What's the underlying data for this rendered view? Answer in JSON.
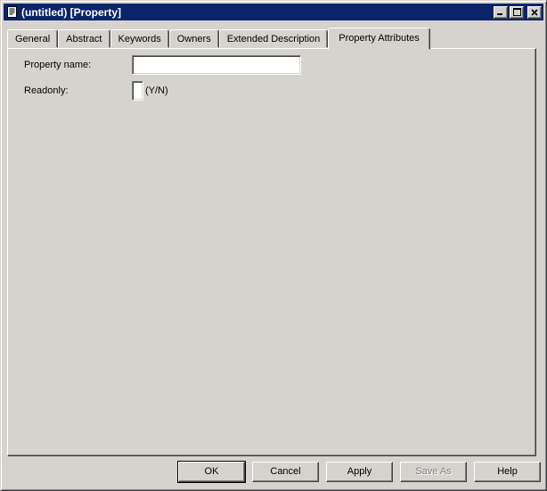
{
  "window": {
    "title": "(untitled) [Property]",
    "icon": "property-sheet-document-icon",
    "controls": {
      "minimize": "minimize-icon",
      "maximize": "maximize-icon",
      "close": "close-icon"
    }
  },
  "tabs": [
    {
      "label": "General",
      "active": false
    },
    {
      "label": "Abstract",
      "active": false
    },
    {
      "label": "Keywords",
      "active": false
    },
    {
      "label": "Owners",
      "active": false
    },
    {
      "label": "Extended Description",
      "active": false
    },
    {
      "label": "Property Attributes",
      "active": true
    }
  ],
  "form": {
    "property_name": {
      "label": "Property name:",
      "value": ""
    },
    "readonly": {
      "label": "Readonly:",
      "value": "",
      "hint": "(Y/N)"
    }
  },
  "buttons": [
    {
      "label": "OK",
      "default": true,
      "enabled": true
    },
    {
      "label": "Cancel",
      "default": false,
      "enabled": true
    },
    {
      "label": "Apply",
      "default": false,
      "enabled": true
    },
    {
      "label": "Save As",
      "default": false,
      "enabled": false
    },
    {
      "label": "Help",
      "default": false,
      "enabled": true
    }
  ],
  "colors": {
    "titlebar": "#0a246a",
    "titlebar_text": "#ffffff",
    "face": "#d6d3ce",
    "highlight": "#ffffff",
    "shadow": "#808080",
    "dark_shadow": "#404040",
    "field_background": "#ffffff",
    "disabled_text": "#808080"
  }
}
